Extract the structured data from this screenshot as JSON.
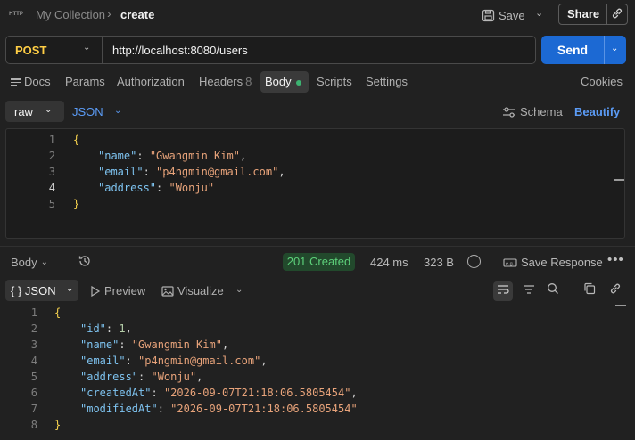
{
  "header": {
    "app_icon": "http-icon",
    "app_icon_text": "HTTP",
    "collection": "My Collection",
    "separator": "›",
    "request_name": "create",
    "save_label": "Save",
    "share_label": "Share"
  },
  "request": {
    "method": "POST",
    "url": "http://localhost:8080/users",
    "send_label": "Send",
    "method_color": "#ffce45",
    "send_color": "#1c69d3"
  },
  "request_tabs": {
    "docs": "Docs",
    "params": "Params",
    "authorization": "Authorization",
    "headers": "Headers",
    "headers_count": "8",
    "body": "Body",
    "scripts": "Scripts",
    "settings": "Settings",
    "cookies": "Cookies"
  },
  "body_bar": {
    "mode": "raw",
    "language": "JSON",
    "schema": "Schema",
    "beautify": "Beautify"
  },
  "request_body": {
    "lines": [
      {
        "no": "1",
        "text": "{"
      },
      {
        "no": "2",
        "key": "\"name\"",
        "value": "\"Gwangmin Kim\"",
        "tail": ","
      },
      {
        "no": "3",
        "key": "\"email\"",
        "value": "\"p4ngmin@gmail.com\"",
        "tail": ","
      },
      {
        "no": "4",
        "key": "\"address\"",
        "value": "\"Wonju\"",
        "tail": ""
      },
      {
        "no": "5",
        "text": "}"
      }
    ]
  },
  "response": {
    "body_label": "Body",
    "status": "201 Created",
    "status_color": "#5dd07a",
    "time": "424 ms",
    "size": "323 B",
    "save_response": "Save Response",
    "view_mode": "{ } JSON",
    "preview": "Preview",
    "visualize": "Visualize"
  },
  "response_body": {
    "lines": [
      {
        "no": "1",
        "text": "{"
      },
      {
        "no": "2",
        "key": "\"id\"",
        "value": "1",
        "tail": ",",
        "numeric": true
      },
      {
        "no": "3",
        "key": "\"name\"",
        "value": "\"Gwangmin Kim\"",
        "tail": ","
      },
      {
        "no": "4",
        "key": "\"email\"",
        "value": "\"p4ngmin@gmail.com\"",
        "tail": ","
      },
      {
        "no": "5",
        "key": "\"address\"",
        "value": "\"Wonju\"",
        "tail": ","
      },
      {
        "no": "6",
        "key": "\"createdAt\"",
        "value": "\"2026-09-07T21:18:06.5805454\"",
        "tail": ","
      },
      {
        "no": "7",
        "key": "\"modifiedAt\"",
        "value": "\"2026-09-07T21:18:06.5805454\"",
        "tail": ""
      },
      {
        "no": "8",
        "text": "}"
      }
    ]
  }
}
